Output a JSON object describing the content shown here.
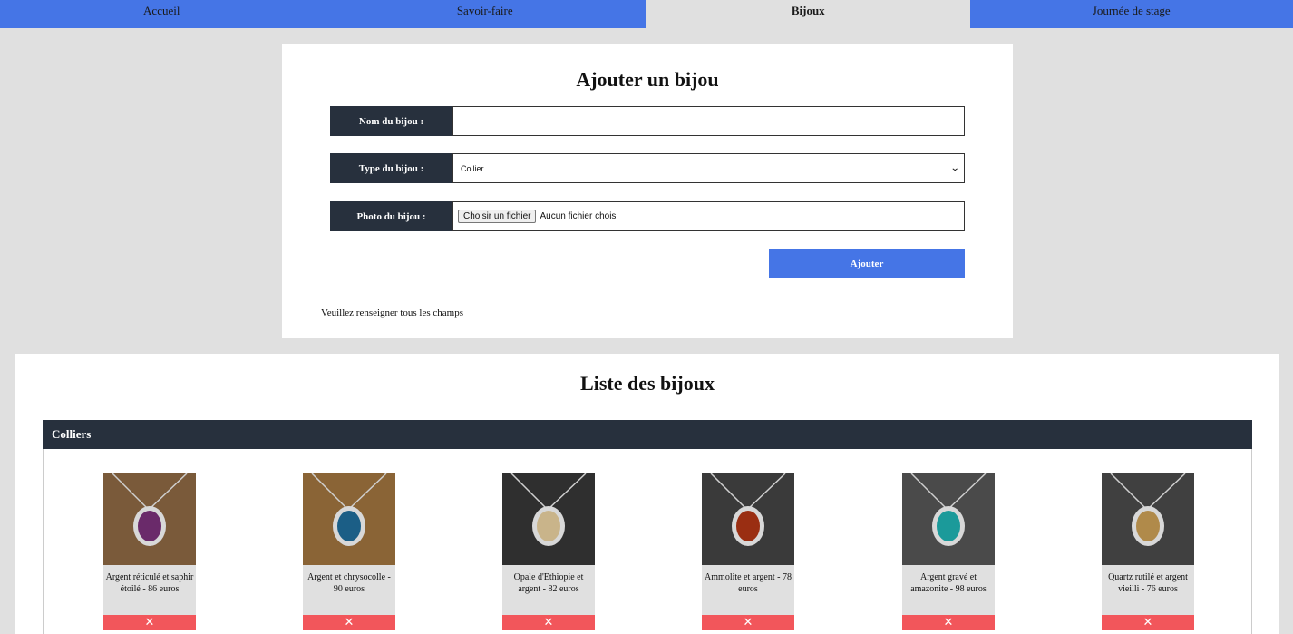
{
  "nav": [
    {
      "label": "Accueil",
      "active": false
    },
    {
      "label": "Savoir-faire",
      "active": false
    },
    {
      "label": "Bijoux",
      "active": true
    },
    {
      "label": "Journée de stage",
      "active": false
    }
  ],
  "form": {
    "title": "Ajouter un bijou",
    "name_label": "Nom du bijou :",
    "name_value": "",
    "type_label": "Type du bijou :",
    "type_value": "Collier",
    "photo_label": "Photo du bijou :",
    "file_button": "Choisir un fichier",
    "file_status": "Aucun fichier choisi",
    "submit_label": "Ajouter",
    "hint": "Veuillez renseigner tous les champs"
  },
  "list": {
    "title": "Liste des bijoux",
    "category": "Colliers",
    "delete_symbol": "✕",
    "items": [
      {
        "caption": "Argent réticulé et saphir étoilé - 86 euros",
        "bg": "#7a5a3a",
        "stone": "#6a2a6a"
      },
      {
        "caption": "Argent et chrysocolle - 90 euros",
        "bg": "#8a6436",
        "stone": "#1b5e86"
      },
      {
        "caption": "Opale d'Ethiopie et argent - 82 euros",
        "bg": "#2f2f2f",
        "stone": "#c9b48a"
      },
      {
        "caption": "Ammolite et argent - 78 euros",
        "bg": "#3a3a3a",
        "stone": "#9a2e12"
      },
      {
        "caption": "Argent gravé et amazonite - 98 euros",
        "bg": "#4a4a4a",
        "stone": "#1b9a9a"
      },
      {
        "caption": "Quartz rutilé et argent vieilli - 76 euros",
        "bg": "#404040",
        "stone": "#b08a4a"
      }
    ]
  }
}
